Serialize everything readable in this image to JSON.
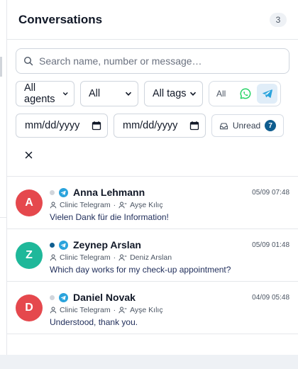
{
  "header": {
    "title": "Conversations",
    "count": "3"
  },
  "filters": {
    "search_placeholder": "Search name, number or message…",
    "agents": "All agents",
    "status": "All",
    "tags": "All tags",
    "channels": {
      "all_label": "All",
      "items": [
        "whatsapp-icon",
        "telegram-icon"
      ],
      "active": "telegram-icon"
    },
    "date_from": "mm/dd/yyyy",
    "date_to": "mm/dd/yyyy",
    "unread_label": "Unread",
    "unread_count": "7"
  },
  "colors": {
    "accent": "#0f5d8f",
    "telegram": "#2aa3dc",
    "whatsapp": "#25d366"
  },
  "conversations": [
    {
      "initial": "A",
      "name": "Anna Lehmann",
      "time": "05/09 07:48",
      "inbox": "Clinic Telegram",
      "agent": "Ayşe Kılıç",
      "preview": "Vielen Dank für die Information!",
      "avatar_color": "#e5484d",
      "status_dot": "#d1d5db",
      "channel": "telegram-icon"
    },
    {
      "initial": "Z",
      "name": "Zeynep Arslan",
      "time": "05/09 01:48",
      "inbox": "Clinic Telegram",
      "agent": "Deniz Arslan",
      "preview": "Which day works for my check-up appointment?",
      "avatar_color": "#1fb89a",
      "status_dot": "#0f5d8f",
      "channel": "telegram-icon"
    },
    {
      "initial": "D",
      "name": "Daniel Novak",
      "time": "04/09 05:48",
      "inbox": "Clinic Telegram",
      "agent": "Ayşe Kılıç",
      "preview": "Understood, thank you.",
      "avatar_color": "#e5484d",
      "status_dot": "#d1d5db",
      "channel": "telegram-icon"
    }
  ]
}
